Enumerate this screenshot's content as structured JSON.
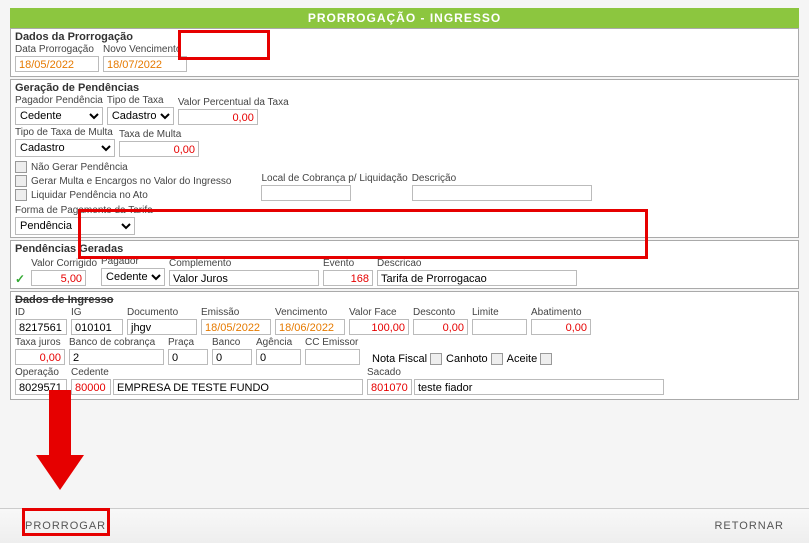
{
  "title": "PRORROGAÇÃO - INGRESSO",
  "sections": {
    "dadosProrrogacao": {
      "label": "Dados da Prorrogação",
      "dataProrrogacaoLabel": "Data Prorrogação",
      "dataProrrogacao": "18/05/2022",
      "novoVencimentoLabel": "Novo Vencimento",
      "novoVencimento": "18/07/2022"
    },
    "geracaoPendencias": {
      "label": "Geração de Pendências",
      "pagadorPendenciaLabel": "Pagador Pendência",
      "pagadorPendencia": "Cedente",
      "tipoTaxaLabel": "Tipo de Taxa",
      "tipoTaxa": "Cadastro",
      "valorPercentualLabel": "Valor Percentual da Taxa",
      "valorPercentual": "0,00",
      "tipoTaxaMultaLabel": "Tipo de Taxa de Multa",
      "tipoTaxaMulta": "Cadastro",
      "taxaMultaLabel": "Taxa de Multa",
      "taxaMulta": "0,00",
      "naoGerarPendencia": "Não Gerar Pendência",
      "gerarMultaEncargos": "Gerar Multa e Encargos no Valor do Ingresso",
      "liquidarPendencia": "Liquidar Pendência no Ato",
      "localCobrancaLabel": "Local de Cobrança p/ Liquidação",
      "descricaoLabel": "Descrição",
      "formaPagamentoLabel": "Forma de Pagamento da Tarifa",
      "formaPagamento": "Pendência"
    },
    "pendenciasGeradas": {
      "label": "Pendências Geradas",
      "valorCorrigidoLabel": "Valor Corrigido",
      "valorCorrigido": "5,00",
      "pagadorLabel": "Pagador",
      "pagador": "Cedente",
      "complementoLabel": "Complemento",
      "complemento": "Valor Juros",
      "eventoLabel": "Evento",
      "evento": "168",
      "descricaoLabel": "Descricao",
      "descricao": "Tarifa de Prorrogacao"
    },
    "dadosIngresso": {
      "label": "Dados de Ingresso",
      "idLabel": "ID",
      "id": "8217561",
      "igLabel": "IG",
      "ig": "010101",
      "documentoLabel": "Documento",
      "documento": "jhgv",
      "emissaoLabel": "Emissão",
      "emissao": "18/05/2022",
      "vencimentoLabel": "Vencimento",
      "vencimento": "18/06/2022",
      "valorFaceLabel": "Valor Face",
      "valorFace": "100,00",
      "descontoLabel": "Desconto",
      "desconto": "0,00",
      "limiteLabel": "Limite",
      "limite": "",
      "abatimentoLabel": "Abatimento",
      "abatimento": "0,00",
      "taxaJurosLabel": "Taxa juros",
      "taxaJuros": "0,00",
      "bancoCobrancaLabel": "Banco de cobrança",
      "bancoCobranca": "2",
      "pracaLabel": "Praça",
      "praca": "0",
      "bancoLabel": "Banco",
      "banco": "0",
      "agenciaLabel": "Agência",
      "agencia": "0",
      "ccEmissorLabel": "CC Emissor",
      "notaFiscalLabel": "Nota Fiscal",
      "canhotoLabel": "Canhoto",
      "aceiteLabel": "Aceite",
      "operacaoLabel": "Operação",
      "operacao": "8029571",
      "cedenteLabel": "Cedente",
      "cedenteCod": "80000",
      "cedenteNome": "EMPRESA DE TESTE FUNDO",
      "sacadoLabel": "Sacado",
      "sacadoCod": "801070",
      "sacadoNome": "teste fiador"
    }
  },
  "footer": {
    "prorrogar": "PRORROGAR",
    "retornar": "RETORNAR"
  }
}
